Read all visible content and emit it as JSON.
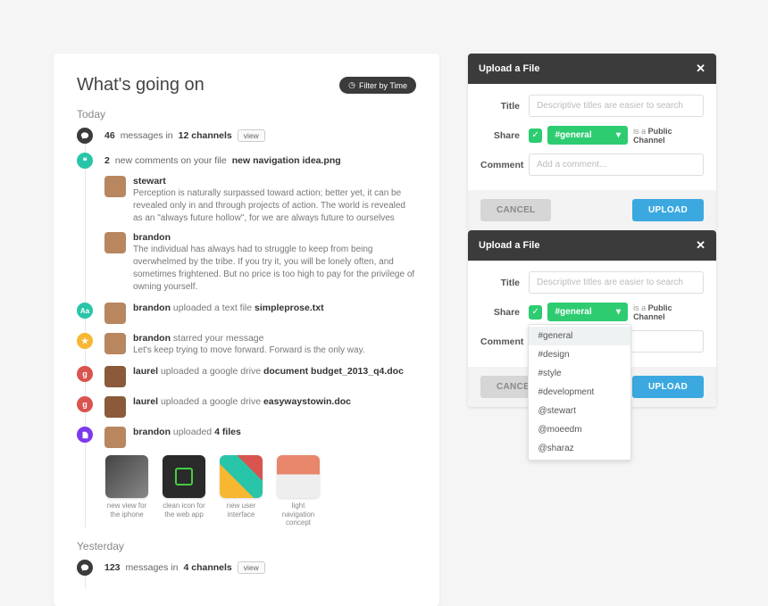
{
  "activity": {
    "title": "What's going on",
    "filter_label": "Filter by Time",
    "sections": {
      "today": "Today",
      "yesterday": "Yesterday"
    },
    "today_summary": {
      "count": "46",
      "messages": "messages in",
      "channels": "12 channels",
      "view": "view"
    },
    "file_comments": {
      "count": "2",
      "prefix": "new comments on your file",
      "file": "new navigation idea.png",
      "comments": [
        {
          "user": "stewart",
          "text": "Perception is naturally surpassed toward action; better yet, it can be revealed only in and through projects of action. The world is revealed as an \"always future hollow\", for we are always future to ourselves"
        },
        {
          "user": "brandon",
          "text": "The individual has always had to struggle to keep from being overwhelmed by the tribe. If you try it, you will be lonely often, and sometimes frightened. But no price is too high to pay for the privilege of owning yourself."
        }
      ]
    },
    "text_upload": {
      "user": "brandon",
      "action": "uploaded a text file",
      "file": "simpleprose.txt"
    },
    "starred": {
      "user": "brandon",
      "action": "starred your message",
      "quote": "Let's keep trying to move forward. Forward is the only way."
    },
    "gdrive": [
      {
        "user": "laurel",
        "action": "uploaded a google drive",
        "type": "document",
        "file": "budget_2013_q4.doc"
      },
      {
        "user": "laurel",
        "action": "uploaded a google drive",
        "type": "",
        "file": "easywaystowin.doc"
      }
    ],
    "multi_upload": {
      "user": "brandon",
      "action": "uploaded",
      "count": "4 files",
      "files": [
        {
          "caption": "new view for the iphone"
        },
        {
          "caption": "clean icon for the web app"
        },
        {
          "caption": "new user interface"
        },
        {
          "caption": "light navigation concept"
        }
      ]
    },
    "yesterday_summary": {
      "count": "123",
      "messages": "messages in",
      "channels": "4 channels",
      "view": "view"
    }
  },
  "upload": {
    "title": "Upload a File",
    "labels": {
      "title": "Title",
      "share": "Share",
      "comment": "Comment"
    },
    "placeholders": {
      "title": "Descriptive titles are easier to search",
      "comment": "Add a comment..."
    },
    "channel": "#general",
    "hint_prefix": "is a",
    "hint_strong": "Public Channel",
    "buttons": {
      "cancel": "CANCEL",
      "upload": "UPLOAD"
    },
    "options": [
      "#general",
      "#design",
      "#style",
      "#development",
      "@stewart",
      "@moeedm",
      "@sharaz"
    ]
  }
}
